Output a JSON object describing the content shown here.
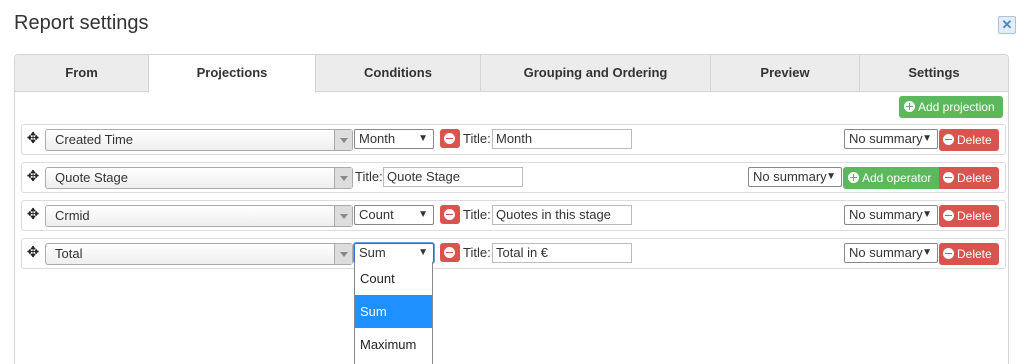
{
  "dialog": {
    "title": "Report settings",
    "close_icon": "close-icon"
  },
  "tabs": [
    {
      "label": "From"
    },
    {
      "label": "Projections"
    },
    {
      "label": "Conditions"
    },
    {
      "label": "Grouping and Ordering"
    },
    {
      "label": "Preview"
    },
    {
      "label": "Settings"
    }
  ],
  "active_tab": "Projections",
  "add_projection_label": "Add projection",
  "title_label": "Title:",
  "delete_label": "Delete",
  "add_operator_label": "Add operator",
  "rows": [
    {
      "field": "Created Time",
      "operator": "Month",
      "title": "Month",
      "summary": "No summary"
    },
    {
      "field": "Quote Stage",
      "title": "Quote Stage",
      "summary": "No summary"
    },
    {
      "field": "Crmid",
      "operator": "Count",
      "title": "Quotes in this stage",
      "summary": "No summary"
    },
    {
      "field": "Total",
      "operator": "Sum",
      "title": "Total in €",
      "summary": "No summary"
    }
  ],
  "operator_dropdown": {
    "options": [
      "Count",
      "Sum",
      "Maximum"
    ],
    "selected": "Sum"
  },
  "colors": {
    "green": "#5cb85c",
    "red": "#d9534f",
    "highlight": "#1e90ff"
  }
}
